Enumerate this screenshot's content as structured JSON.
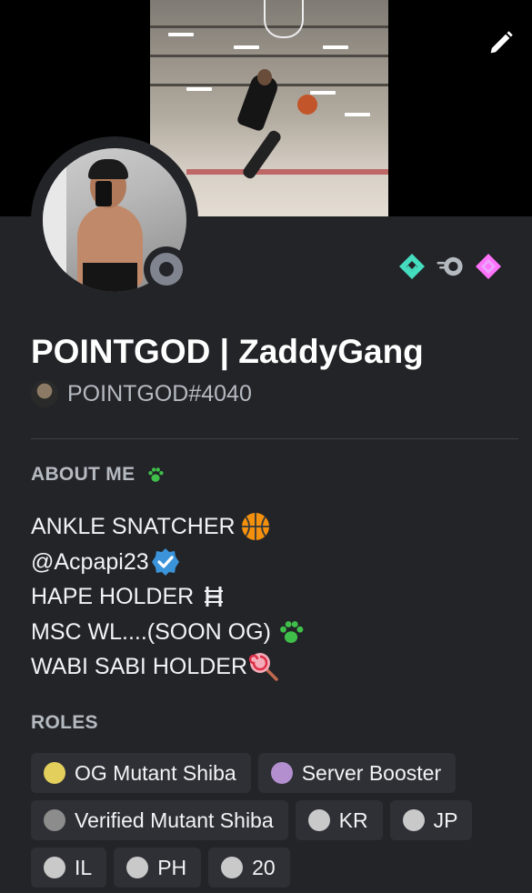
{
  "profile": {
    "display_name": "POINTGOD | ZaddyGang",
    "tag": "POINTGOD#4040",
    "status": "offline"
  },
  "icons": {
    "edit": "pencil-icon",
    "badges": [
      "hypesquad-balance-icon",
      "nitro-icon",
      "server-boost-icon"
    ]
  },
  "about": {
    "title": "ABOUT ME",
    "title_emoji": "paw-icon",
    "lines": [
      {
        "text": "ANKLE SNATCHER",
        "emoji": "basketball-icon"
      },
      {
        "text": "@Acpapi23",
        "emoji": "verified-icon"
      },
      {
        "text": "HAPE HOLDER ",
        "emoji": "hape-logo-icon"
      },
      {
        "text": "MSC WL....(SOON OG)",
        "emoji": "paw-icon"
      },
      {
        "text": "WABI SABI HOLDER",
        "emoji": "lollipop-icon"
      }
    ]
  },
  "roles": {
    "title": "ROLES",
    "items": [
      {
        "name": "OG Mutant Shiba",
        "color": "#e3cf5c"
      },
      {
        "name": "Server Booster",
        "color": "#b38fd0"
      },
      {
        "name": "Verified Mutant Shiba",
        "color": "#8c8c8c"
      },
      {
        "name": "KR",
        "color": "#c9c9c9"
      },
      {
        "name": "JP",
        "color": "#c9c9c9"
      },
      {
        "name": "IL",
        "color": "#c9c9c9"
      },
      {
        "name": "PH",
        "color": "#c9c9c9"
      },
      {
        "name": "20",
        "color": "#c9c9c9"
      }
    ]
  },
  "colors": {
    "background": "#232428",
    "role_bg": "#2e3035",
    "muted_text": "#b5bac1",
    "status_offline": "#80848e"
  }
}
